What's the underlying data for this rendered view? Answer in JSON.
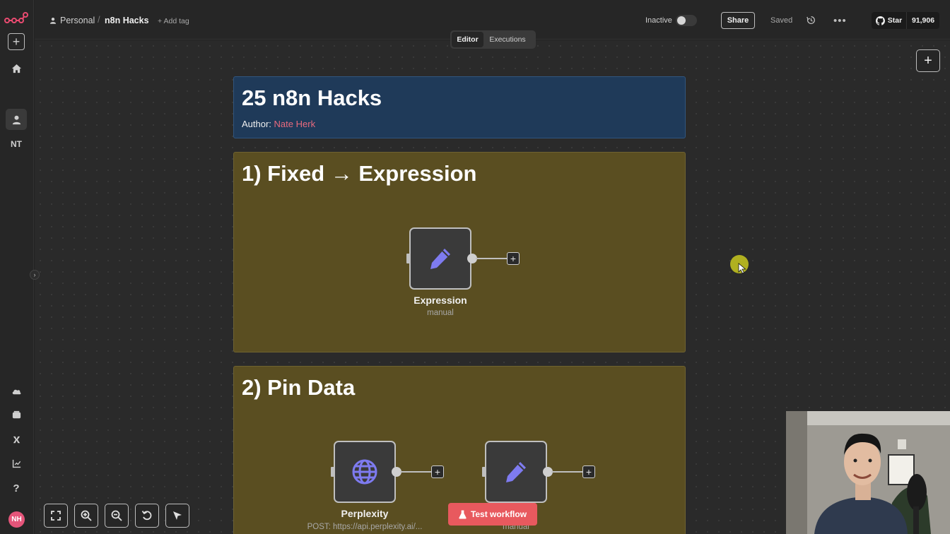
{
  "sidebar": {
    "workspace_initials": "NT",
    "avatar_initials": "NH"
  },
  "header": {
    "project": "Personal",
    "workflow_name": "n8n Hacks",
    "add_tag": "+ Add tag",
    "status_label": "Inactive",
    "share_label": "Share",
    "saved_label": "Saved",
    "more_label": "•••",
    "github_star_label": "Star",
    "github_star_count": "91,906"
  },
  "tabs": {
    "editor": "Editor",
    "executions": "Executions"
  },
  "canvas": {
    "title_note": {
      "title": "25 n8n Hacks",
      "author_label": "Author:",
      "author_name": "Nate Herk"
    },
    "note1": {
      "title": "1) Fixed → Expression",
      "nodes": [
        {
          "label": "Expression",
          "subtitle": "manual"
        }
      ]
    },
    "note2": {
      "title": "2) Pin Data",
      "nodes": [
        {
          "label": "Perplexity",
          "subtitle": "POST: https://api.perplexity.ai/..."
        },
        {
          "label": "",
          "subtitle": "manual"
        }
      ]
    },
    "add_label": "+",
    "test_workflow_label": "Test workflow"
  },
  "colors": {
    "accent": "#e8595e",
    "note_blue": "#1f3a59",
    "note_olive": "#5a4e21",
    "node_icon": "#7e7bf0",
    "author_name": "#e86a7e"
  }
}
